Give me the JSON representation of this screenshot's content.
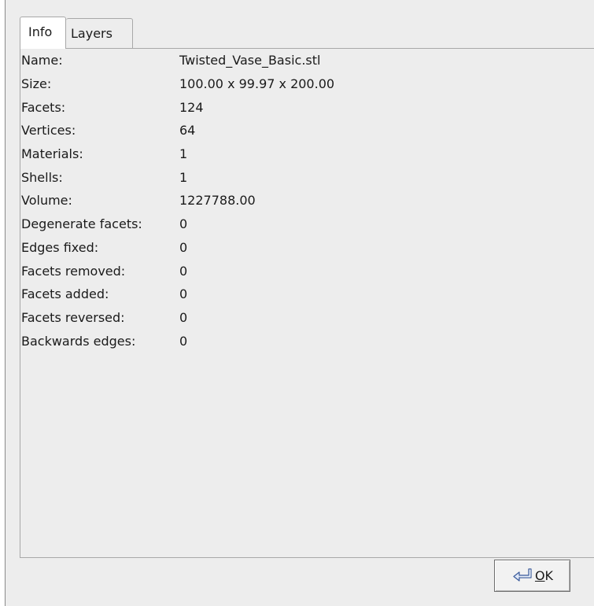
{
  "tabs": [
    {
      "label": "Info",
      "active": true
    },
    {
      "label": "Layers",
      "active": false
    }
  ],
  "info": [
    {
      "label": "Name:",
      "value": "Twisted_Vase_Basic.stl"
    },
    {
      "label": "Size:",
      "value": "100.00 x 99.97 x 200.00"
    },
    {
      "label": "Facets:",
      "value": "124"
    },
    {
      "label": "Vertices:",
      "value": "64"
    },
    {
      "label": "Materials:",
      "value": "1"
    },
    {
      "label": "Shells:",
      "value": "1"
    },
    {
      "label": "Volume:",
      "value": "1227788.00"
    },
    {
      "label": "Degenerate facets:",
      "value": "0"
    },
    {
      "label": "Edges fixed:",
      "value": "0"
    },
    {
      "label": "Facets removed:",
      "value": "0"
    },
    {
      "label": "Facets added:",
      "value": "0"
    },
    {
      "label": "Facets reversed:",
      "value": "0"
    },
    {
      "label": "Backwards edges:",
      "value": "0"
    }
  ],
  "ok_button": {
    "mnemonic": "O",
    "rest": "K",
    "icon": "enter-return-icon"
  }
}
